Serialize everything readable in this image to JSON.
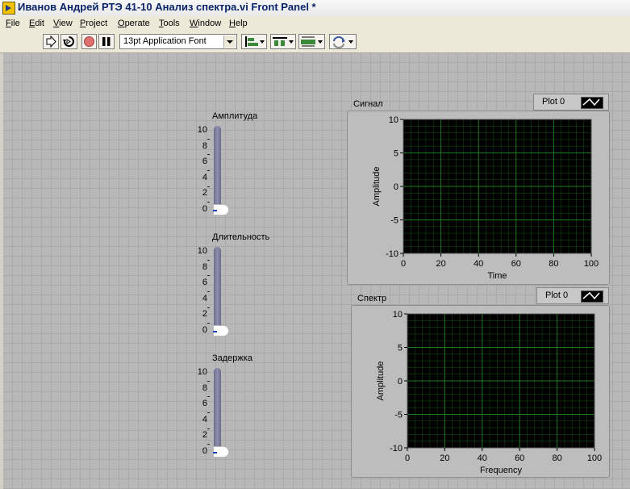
{
  "window": {
    "title": "Иванов Андрей РТЭ 41-10 Анализ спектра.vi Front Panel *"
  },
  "menu": [
    {
      "label": "File",
      "key": "F"
    },
    {
      "label": "Edit",
      "key": "E"
    },
    {
      "label": "View",
      "key": "V"
    },
    {
      "label": "Project",
      "key": "P"
    },
    {
      "label": "Operate",
      "key": "O"
    },
    {
      "label": "Tools",
      "key": "T"
    },
    {
      "label": "Window",
      "key": "W"
    },
    {
      "label": "Help",
      "key": "H"
    }
  ],
  "toolbar": {
    "font": "13pt Application Font",
    "buttons": [
      "run-arrow-icon",
      "run-continuously-icon",
      "abort-icon",
      "pause-icon",
      "align-objects-icon",
      "distribute-objects-icon",
      "resize-objects-icon",
      "reorder-icon"
    ]
  },
  "controls": [
    {
      "label": "Амплитуда",
      "min": 0,
      "max": 10,
      "value": 0,
      "ticks": [
        "10",
        "8",
        "6",
        "4",
        "2",
        "0"
      ]
    },
    {
      "label": "Длительность",
      "min": 0,
      "max": 10,
      "value": 0,
      "ticks": [
        "10",
        "8",
        "6",
        "4",
        "2",
        "0"
      ]
    },
    {
      "label": "Задержка",
      "min": 0,
      "max": 10,
      "value": 0,
      "ticks": [
        "10",
        "8",
        "6",
        "4",
        "2",
        "0"
      ]
    }
  ],
  "graphs": [
    {
      "label": "Сигнал",
      "legend": "Plot 0",
      "xlabel": "Time",
      "ylabel": "Amplitude",
      "x_ticks": [
        "0",
        "20",
        "40",
        "60",
        "80",
        "100"
      ],
      "y_ticks": [
        "10",
        "5",
        "0",
        "-5",
        "-10"
      ],
      "xlim": [
        0,
        100
      ],
      "ylim": [
        -10,
        10
      ],
      "grid": true
    },
    {
      "label": "Спектр",
      "legend": "Plot 0",
      "xlabel": "Frequency",
      "ylabel": "Amplitude",
      "x_ticks": [
        "0",
        "20",
        "40",
        "60",
        "80",
        "100"
      ],
      "y_ticks": [
        "10",
        "5",
        "0",
        "-5",
        "-10"
      ],
      "xlim": [
        0,
        100
      ],
      "ylim": [
        -10,
        10
      ],
      "grid": true
    }
  ],
  "colors": {
    "plot_bg": "#000000",
    "grid": "#1e7a1e",
    "panel": "#b8b8b8"
  }
}
